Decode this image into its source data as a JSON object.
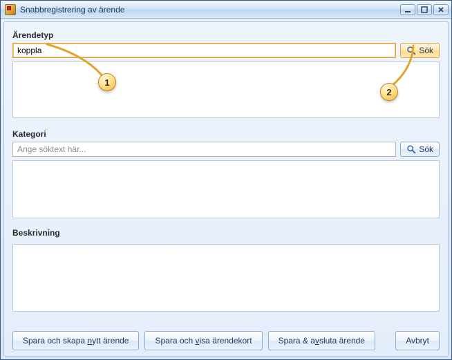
{
  "window": {
    "title": "Snabbregistrering av ärende"
  },
  "sections": {
    "arendetyp": {
      "label": "Ärendetyp",
      "input_value": "koppla",
      "search_label": "Sök"
    },
    "kategori": {
      "label": "Kategori",
      "placeholder": "Ange söktext här...",
      "search_label": "Sök"
    },
    "beskrivning": {
      "label": "Beskrivning"
    }
  },
  "footer": {
    "btn_new": {
      "pre": "Spara och skapa ",
      "ul": "n",
      "post": "ytt ärende"
    },
    "btn_view": {
      "pre": "Spara och ",
      "ul": "v",
      "post": "isa ärendekort"
    },
    "btn_close": {
      "pre": "Spara & a",
      "ul": "v",
      "post": "sluta ärende"
    },
    "btn_cancel": "Avbryt"
  },
  "callouts": {
    "c1": "1",
    "c2": "2"
  }
}
